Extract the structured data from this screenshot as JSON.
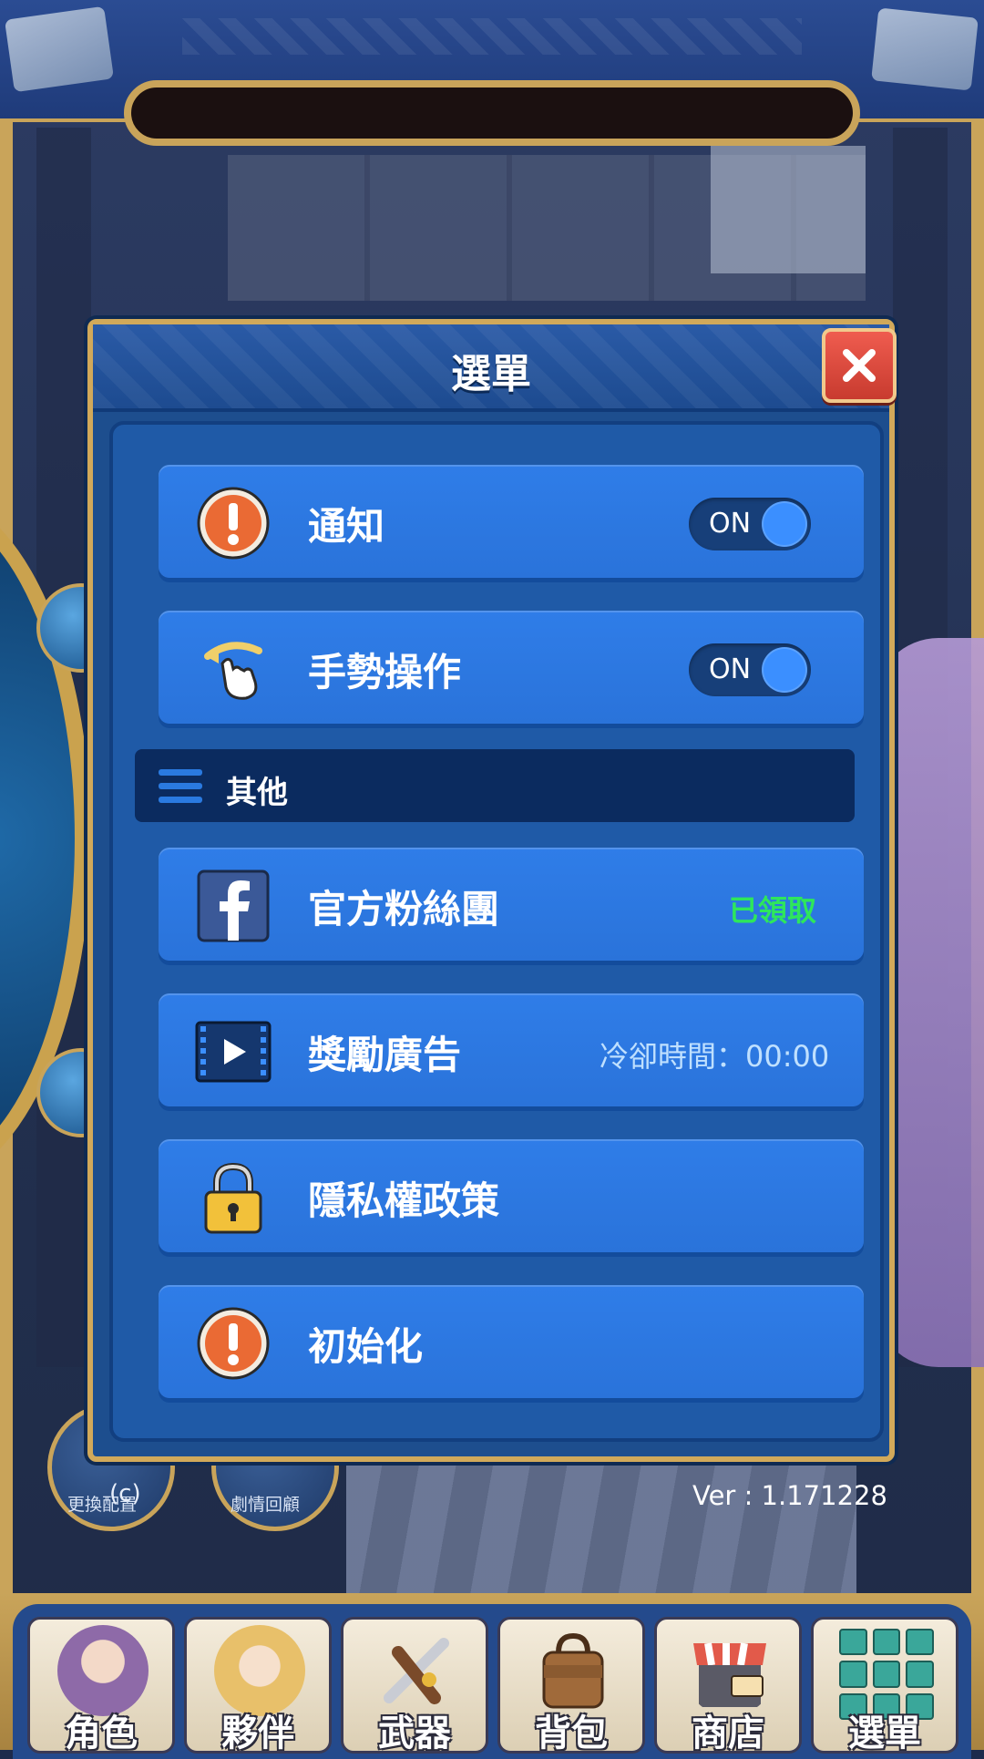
{
  "dialog": {
    "title": "選單",
    "rows": [
      {
        "label": "通知",
        "toggle": "ON",
        "icon": "alert-icon"
      },
      {
        "label": "手勢操作",
        "toggle": "ON",
        "icon": "gesture-icon"
      }
    ],
    "section_label": "其他",
    "other_rows": [
      {
        "label": "官方粉絲團",
        "status": "已領取",
        "icon": "facebook-icon"
      },
      {
        "label": "獎勵廣告",
        "status": "冷卻時間：00:00",
        "icon": "video-play-icon"
      },
      {
        "label": "隱私權政策",
        "icon": "lock-icon"
      },
      {
        "label": "初始化",
        "icon": "alert-icon"
      }
    ]
  },
  "background": {
    "left_button_label": "更換配置",
    "story_button_label": "劇情回顧",
    "copyright": "(c)",
    "version": "Ver : 1.171228"
  },
  "bottom_nav": {
    "items": [
      {
        "label": "角色",
        "icon": "character-icon"
      },
      {
        "label": "夥伴",
        "icon": "companion-icon"
      },
      {
        "label": "武器",
        "icon": "weapon-icon"
      },
      {
        "label": "背包",
        "icon": "bag-icon"
      },
      {
        "label": "商店",
        "icon": "shop-icon"
      },
      {
        "label": "選單",
        "icon": "menu-grid-icon"
      }
    ]
  },
  "colors": {
    "dialog_bg": "#1d4e8e",
    "row_bg": "#2f7de8",
    "gold_border": "#d1a95a",
    "close_red": "#e0493d",
    "status_green": "#2ee65c",
    "status_blue": "#bfe0ff"
  }
}
